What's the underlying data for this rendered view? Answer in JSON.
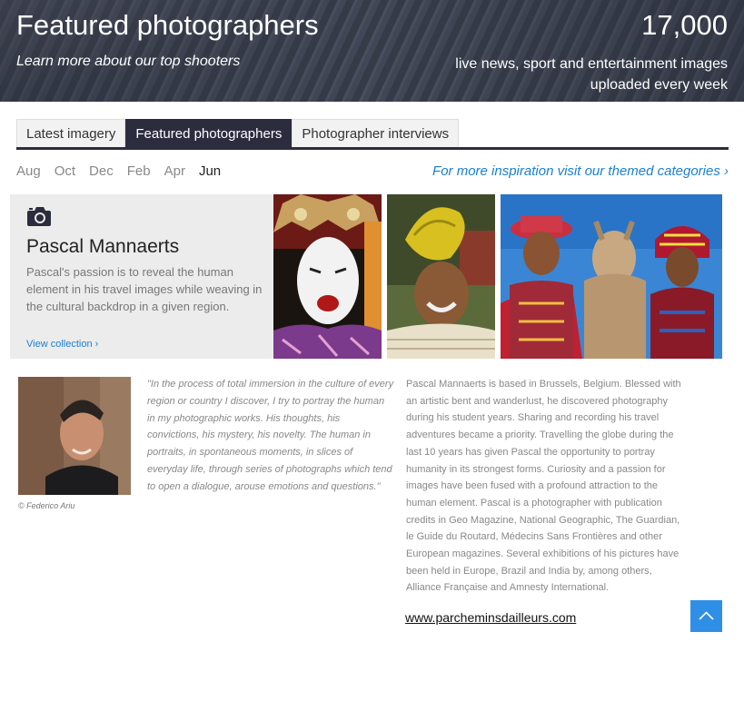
{
  "banner": {
    "title": "Featured photographers",
    "subtitle": "Learn more about our top shooters",
    "count": "17,000",
    "description": "live news, sport and entertainment images uploaded every week"
  },
  "tabs": [
    {
      "label": "Latest imagery",
      "active": false
    },
    {
      "label": "Featured photographers",
      "active": true
    },
    {
      "label": "Photographer interviews",
      "active": false
    }
  ],
  "months": [
    {
      "label": "Aug",
      "active": false
    },
    {
      "label": "Oct",
      "active": false
    },
    {
      "label": "Dec",
      "active": false
    },
    {
      "label": "Feb",
      "active": false
    },
    {
      "label": "Apr",
      "active": false
    },
    {
      "label": "Jun",
      "active": true
    }
  ],
  "inspiration_link": "For more inspiration visit our themed categories ›",
  "feature": {
    "icon": "camera-icon",
    "name": "Pascal Mannaerts",
    "description": "Pascal's passion is to reveal the human element in his travel images while weaving in the cultural backdrop in a given region.",
    "link": "View collection ›"
  },
  "portrait_credit": "© Federico Ariu",
  "quote": "\"In the process of total immersion in the culture of every region or country I discover, I try to portray the human in my photographic works. His thoughts, his convictions, his mystery, his novelty. The human in portraits, in spontaneous moments, in slices of everyday life, through series of photographs which tend to open a dialogue, arouse emotions and questions.\"",
  "bio": "Pascal Mannaerts is based in Brussels, Belgium. Blessed with an artistic bent and wanderlust, he discovered photography during his student years. Sharing and recording his travel adventures became a priority. Travelling the globe during the last 10 years has given Pascal the opportunity to portray humanity in its strongest forms. Curiosity and a passion for images have been fused with a profound attraction to the human element. Pascal is a photographer with publication credits in Geo Magazine, National Geographic, The Guardian, le Guide du Routard, Médecins Sans Frontières and other European magazines. Several exhibitions of his pictures have been held in Europe, Brazil and India by, among others, Alliance Française and Amnesty International.",
  "website": "www.parcheminsdailleurs.com",
  "back_to_top_icon": "chevron-up-icon",
  "colors": {
    "accent": "#2b2d3e",
    "link": "#1a7fd0",
    "back_to_top": "#2f8fe6"
  }
}
